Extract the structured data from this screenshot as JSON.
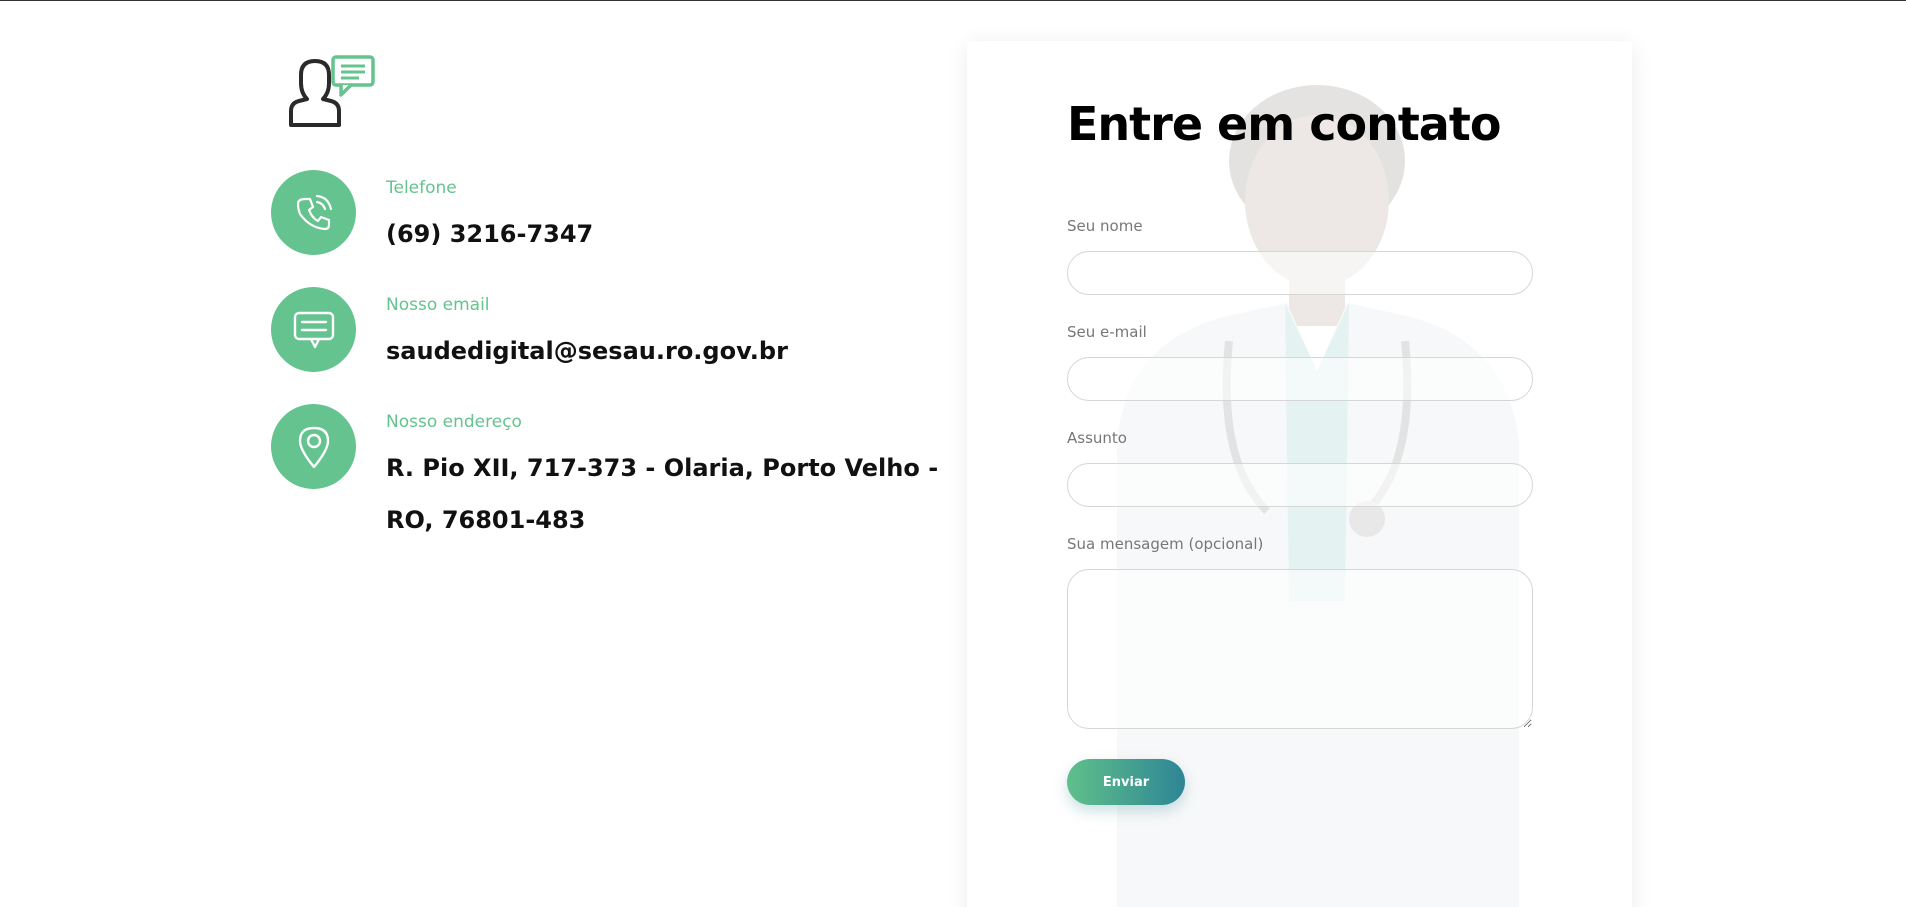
{
  "contact_info": {
    "phone": {
      "label": "Telefone",
      "value": "(69) 3216-7347",
      "icon": "phone-icon"
    },
    "email": {
      "label": "Nosso email",
      "value": "saudedigital@sesau.ro.gov.br",
      "icon": "chat-icon"
    },
    "address": {
      "label": "Nosso endereço",
      "value": "R. Pio XII, 717-373 - Olaria, Porto Velho - RO, 76801-483",
      "icon": "map-pin-icon"
    }
  },
  "form": {
    "title": "Entre em contato",
    "name_label": "Seu nome",
    "name_value": "",
    "email_label": "Seu e-mail",
    "email_value": "",
    "subject_label": "Assunto",
    "subject_value": "",
    "message_label": "Sua mensagem (opcional)",
    "message_value": "",
    "submit_label": "Enviar"
  },
  "colors": {
    "accent_green": "#64c38e",
    "button_gradient_start": "#5fc08a",
    "button_gradient_end": "#2e8595",
    "text_dark": "#111111",
    "label_gray": "#777777"
  }
}
